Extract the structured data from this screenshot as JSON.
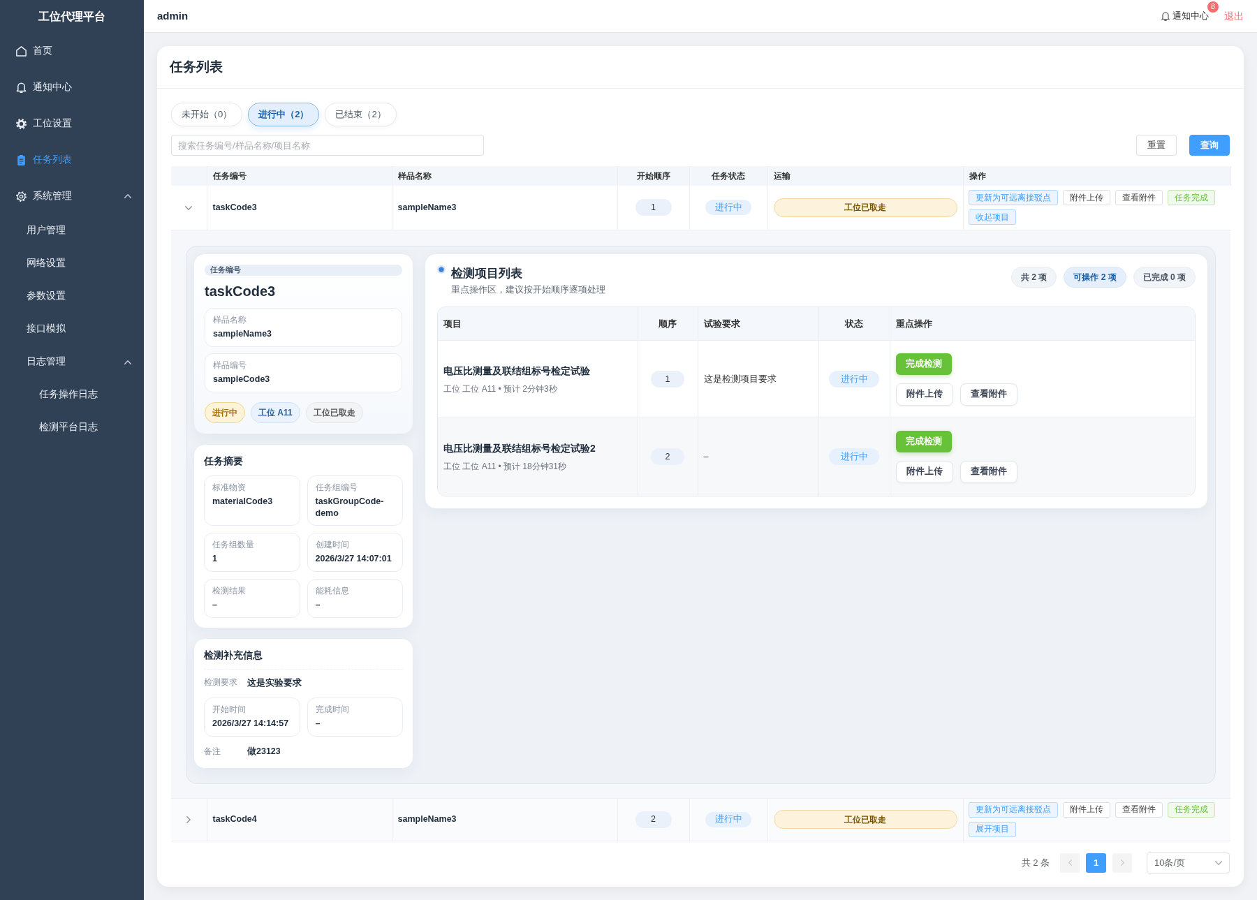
{
  "sidebar": {
    "title": "工位代理平台",
    "items": [
      {
        "label": "首页",
        "selected": false
      },
      {
        "label": "通知中心",
        "selected": false
      },
      {
        "label": "工位设置",
        "selected": false
      },
      {
        "label": "任务列表",
        "selected": true
      },
      {
        "label": "系统管理",
        "selected": false,
        "expanded": true,
        "children": [
          {
            "label": "用户管理",
            "selected": false
          },
          {
            "label": "网络设置",
            "selected": false
          },
          {
            "label": "参数设置",
            "selected": false
          },
          {
            "label": "接口模拟",
            "selected": false
          },
          {
            "label": "日志管理",
            "selected": false,
            "expanded": true,
            "children": [
              {
                "label": "任务操作日志",
                "selected": false
              },
              {
                "label": "检测平台日志",
                "selected": false
              }
            ]
          }
        ]
      }
    ]
  },
  "header": {
    "user": "admin",
    "notifications": {
      "label": "通知中心",
      "badge": "8"
    },
    "logout": "退出"
  },
  "main": {
    "title": "任务列表",
    "tabs": [
      {
        "label": "未开始（0）",
        "selected": false
      },
      {
        "label": "进行中（2）",
        "selected": true
      },
      {
        "label": "已结束（2）",
        "selected": false
      }
    ],
    "search": {
      "placeholder": "搜索任务编号/样品名称/项目名称"
    },
    "buttons": [
      {
        "label": "重置",
        "kind": "default"
      },
      {
        "label": "查询",
        "kind": "primary"
      }
    ],
    "table": {
      "columns": [
        "任务编号",
        "样品名称",
        "开始顺序",
        "任务状态",
        "运输",
        "操作"
      ],
      "rows": [
        {
          "expanded": true,
          "task_code": "taskCode3",
          "sample_name": "sampleName3",
          "order": "1",
          "status": "进行中",
          "transport": "工位已取走",
          "actions": [
            {
              "label": "更新为可远离接驳点",
              "kind": "primary"
            },
            {
              "label": "附件上传",
              "kind": "default"
            },
            {
              "label": "查看附件",
              "kind": "default"
            },
            {
              "label": "任务完成",
              "kind": "success"
            },
            {
              "label": "收起项目",
              "kind": "primary"
            }
          ],
          "detail": {
            "task_card": {
              "code_label": "任务编号",
              "code": "taskCode3",
              "fields": [
                {
                  "label": "样品名称",
                  "value": "sampleName3"
                },
                {
                  "label": "样品编号",
                  "value": "sampleCode3"
                }
              ],
              "tags": [
                {
                  "label": "进行中",
                  "kind": "warning"
                },
                {
                  "label": "工位 A11",
                  "kind": "info"
                },
                {
                  "label": "工位已取走",
                  "kind": "neutral"
                }
              ]
            },
            "summary": {
              "title": "任务摘要",
              "fields": [
                {
                  "label": "标准物资",
                  "value": "materialCode3"
                },
                {
                  "label": "任务组编号",
                  "value": "taskGroupCode-demo"
                },
                {
                  "label": "任务组数量",
                  "value": "1"
                },
                {
                  "label": "创建时间",
                  "value": "2026/3/27 14:07:01"
                },
                {
                  "label": "检测结果",
                  "value": "–"
                },
                {
                  "label": "能耗信息",
                  "value": "–"
                }
              ]
            },
            "supplement": {
              "title": "检测补充信息",
              "items": [
                {
                  "kind": "line",
                  "label": "检测要求",
                  "value": "这是实验要求"
                },
                {
                  "kind": "pair",
                  "fields": [
                    {
                      "label": "开始时间",
                      "value": "2026/3/27 14:14:57"
                    },
                    {
                      "label": "完成时间",
                      "value": "–"
                    }
                  ]
                },
                {
                  "kind": "line",
                  "label": "备注",
                  "value": "做23123"
                }
              ]
            },
            "items_panel": {
              "title": "检测项目列表",
              "subtitle": "重点操作区，建议按开始顺序逐项处理",
              "counters": [
                {
                  "label": "共 2 项",
                  "kind": "neutral"
                },
                {
                  "label": "可操作 2 项",
                  "kind": "primary"
                },
                {
                  "label": "已完成 0 项",
                  "kind": "neutral"
                }
              ],
              "columns": [
                "项目",
                "顺序",
                "试验要求",
                "状态",
                "重点操作"
              ],
              "rows": [
                {
                  "name": "电压比测量及联结组标号检定试验",
                  "meta": "工位 工位 A11 • 预计 2分钟3秒",
                  "order": "1",
                  "requirement": "这是检测项目要求",
                  "status": "进行中",
                  "actions": [
                    {
                      "label": "完成检测",
                      "kind": "success"
                    },
                    {
                      "label": "附件上传",
                      "kind": "default"
                    },
                    {
                      "label": "查看附件",
                      "kind": "default"
                    }
                  ]
                },
                {
                  "name": "电压比测量及联结组标号检定试验2",
                  "meta": "工位 工位 A11 • 预计 18分钟31秒",
                  "order": "2",
                  "requirement": "–",
                  "status": "进行中",
                  "actions": [
                    {
                      "label": "完成检测",
                      "kind": "success"
                    },
                    {
                      "label": "附件上传",
                      "kind": "default"
                    },
                    {
                      "label": "查看附件",
                      "kind": "default"
                    }
                  ]
                }
              ]
            }
          }
        },
        {
          "expanded": false,
          "task_code": "taskCode4",
          "sample_name": "sampleName3",
          "order": "2",
          "status": "进行中",
          "transport": "工位已取走",
          "actions": [
            {
              "label": "更新为可远离接驳点",
              "kind": "primary"
            },
            {
              "label": "附件上传",
              "kind": "default"
            },
            {
              "label": "查看附件",
              "kind": "default"
            },
            {
              "label": "任务完成",
              "kind": "success"
            },
            {
              "label": "展开项目",
              "kind": "primary"
            }
          ]
        }
      ]
    },
    "pagination": {
      "total": "共 2 条",
      "prev": {
        "disabled": true
      },
      "pages": [
        {
          "label": "1",
          "selected": true
        }
      ],
      "next": {
        "disabled": true
      },
      "page_size": "10条/页"
    }
  }
}
